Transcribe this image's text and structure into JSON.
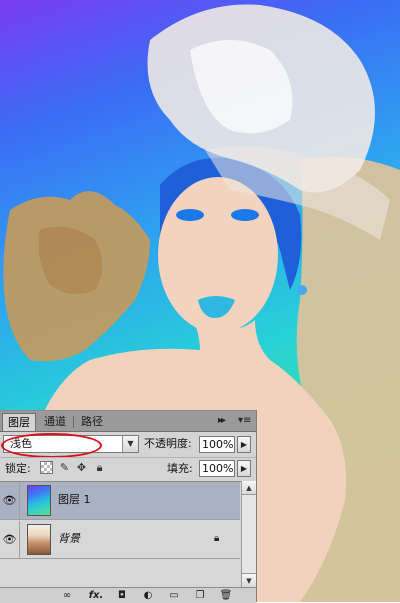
{
  "panel": {
    "tabs": [
      {
        "label": "图层",
        "active": true
      },
      {
        "label": "通道",
        "active": false
      },
      {
        "label": "路径",
        "active": false
      }
    ],
    "collapse_glyph": "▸▸",
    "menu_glyph": "▾≡",
    "blend_mode": {
      "value": "浅色",
      "highlight_color": "#d8101a"
    },
    "opacity": {
      "label": "不透明度:",
      "value": "100%"
    },
    "lock": {
      "label": "锁定:"
    },
    "fill": {
      "label": "填充:",
      "value": "100%"
    },
    "layers": [
      {
        "name": "图层 1",
        "selected": true,
        "visible": true,
        "thumbnail": "gradient"
      },
      {
        "name": "背景",
        "selected": false,
        "visible": true,
        "thumbnail": "photo",
        "locked": true
      }
    ],
    "footer_icons": [
      "link-icon",
      "fx-icon",
      "layer-mask-icon",
      "adjustment-layer-icon",
      "group-folder-icon",
      "new-layer-icon",
      "trash-icon"
    ],
    "footer_labels": {
      "fx": "fx."
    }
  },
  "canvas": {
    "gradient_colors": [
      "#7a3cf0",
      "#3b6cf5",
      "#2fa0f0",
      "#27d0d8",
      "#39e0a8",
      "#74d880"
    ],
    "skin_color": "#f1d2bd",
    "texture_color": "#c9a46a"
  }
}
